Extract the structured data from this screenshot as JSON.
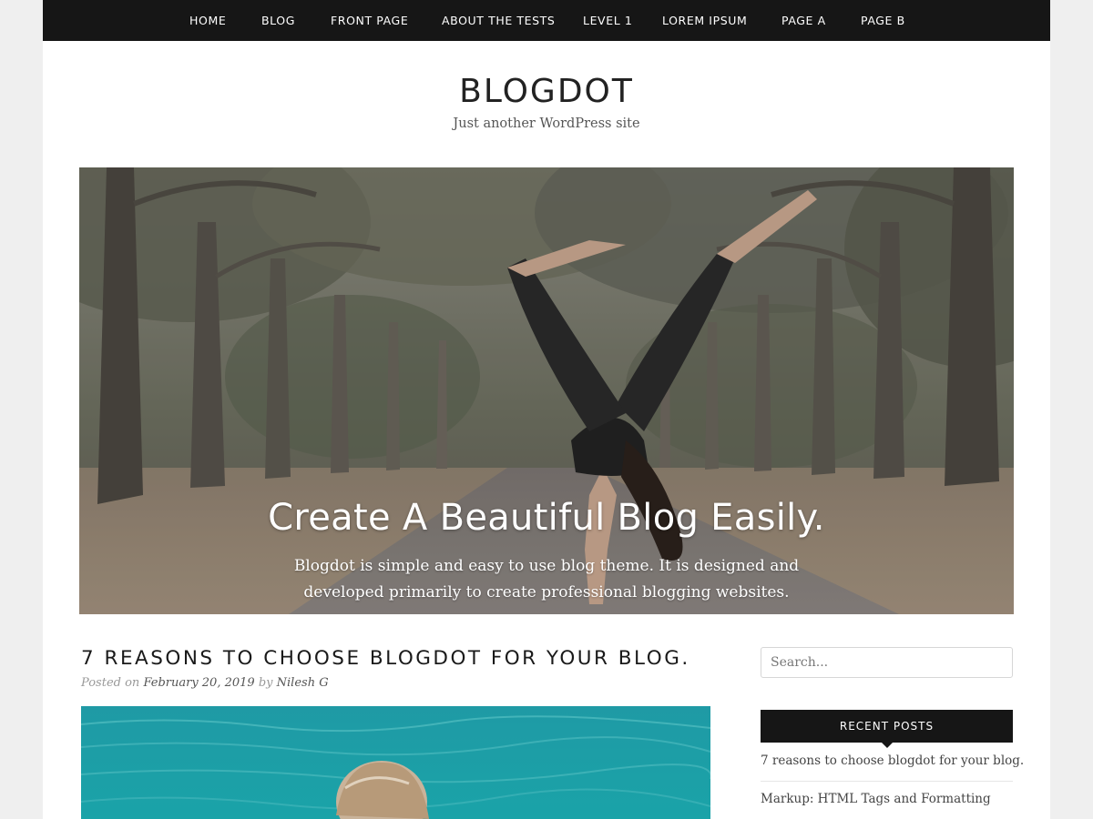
{
  "nav": {
    "items": [
      {
        "label": "HOME"
      },
      {
        "label": "BLOG"
      },
      {
        "label": "FRONT PAGE"
      },
      {
        "label": "ABOUT THE TESTS"
      },
      {
        "label": "LEVEL 1"
      },
      {
        "label": "LOREM IPSUM"
      },
      {
        "label": "PAGE A"
      },
      {
        "label": "PAGE B"
      }
    ]
  },
  "header": {
    "site_title": "BLOGDOT",
    "site_description": "Just another WordPress site"
  },
  "hero": {
    "title": "Create A Beautiful Blog Easily.",
    "text": "Blogdot is simple and easy to use blog theme. It is designed and developed primarily to create professional blogging websites."
  },
  "post": {
    "title": "7 REASONS TO CHOOSE BLOGDOT FOR YOUR BLOG.",
    "posted_on_label": "Posted on",
    "date": "February 20, 2019",
    "by_label": "by",
    "author": "Nilesh G"
  },
  "sidebar": {
    "search_placeholder": "Search...",
    "recent_posts_heading": "RECENT POSTS",
    "recent_posts": [
      {
        "title": "7 reasons to choose blogdot for your blog."
      },
      {
        "title": "Markup: HTML Tags and Formatting"
      }
    ]
  },
  "colors": {
    "nav_background": "#161616",
    "page_background": "#ffffff",
    "outer_background": "#efefef",
    "title_text": "#222222",
    "meta_text": "#999999"
  },
  "icons": {
    "hero_image": "forest-road-handstand-photo",
    "post_image": "sea-water-photo"
  }
}
